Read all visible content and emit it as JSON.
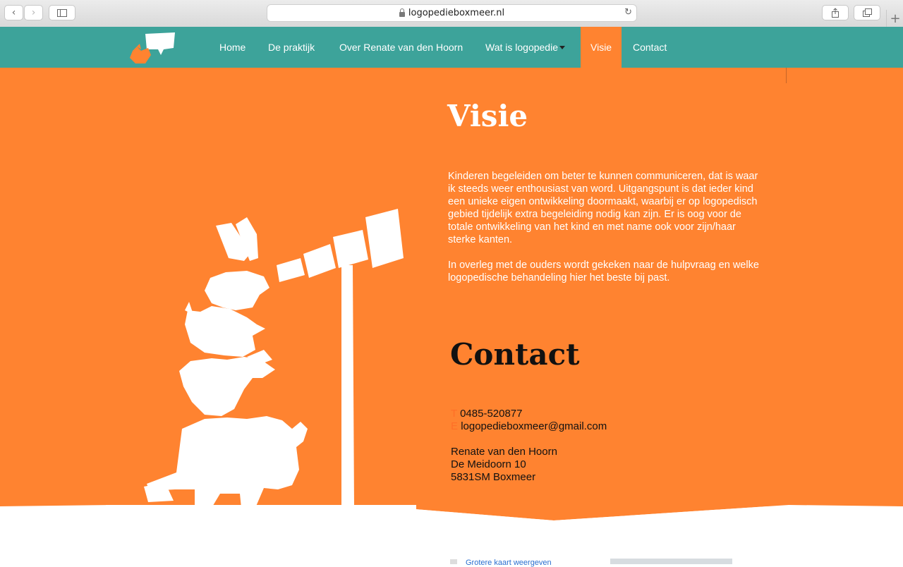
{
  "browser": {
    "url": "logopedieboxmeer.nl"
  },
  "nav": {
    "items": [
      {
        "label": "Home"
      },
      {
        "label": "De praktijk"
      },
      {
        "label": "Over Renate van den Hoorn"
      },
      {
        "label": "Wat is logopedie"
      },
      {
        "label": "Visie"
      },
      {
        "label": "Contact"
      }
    ],
    "active": "Visie"
  },
  "visie": {
    "title": "Visie",
    "paragraph1": "Kinderen begeleiden om beter te kunnen communiceren, dat is waar ik steeds weer enthousiast van word. Uitgangspunt is dat ieder kind een unieke eigen ontwikkeling doormaakt, waarbij er op logopedisch gebied tijdelijk extra begeleiding nodig kan zijn. Er is oog voor de totale ontwikkeling van het kind en met name ook voor zijn/haar sterke kanten.",
    "paragraph2": "In overleg met de ouders wordt gekeken naar de hulpvraag en welke logopedische behandeling hier het beste bij past."
  },
  "contact": {
    "title": "Contact",
    "phone_label": "T",
    "phone": "0485-520877",
    "email_label": "E",
    "email": "logopedieboxmeer@gmail.com",
    "name": "Renate van den Hoorn",
    "street": "De Meidoorn 10",
    "city": "5831SM Boxmeer"
  },
  "map": {
    "link": "Grotere kaart weergeven"
  },
  "colors": {
    "teal": "#3da39a",
    "orange": "#ff8330"
  }
}
